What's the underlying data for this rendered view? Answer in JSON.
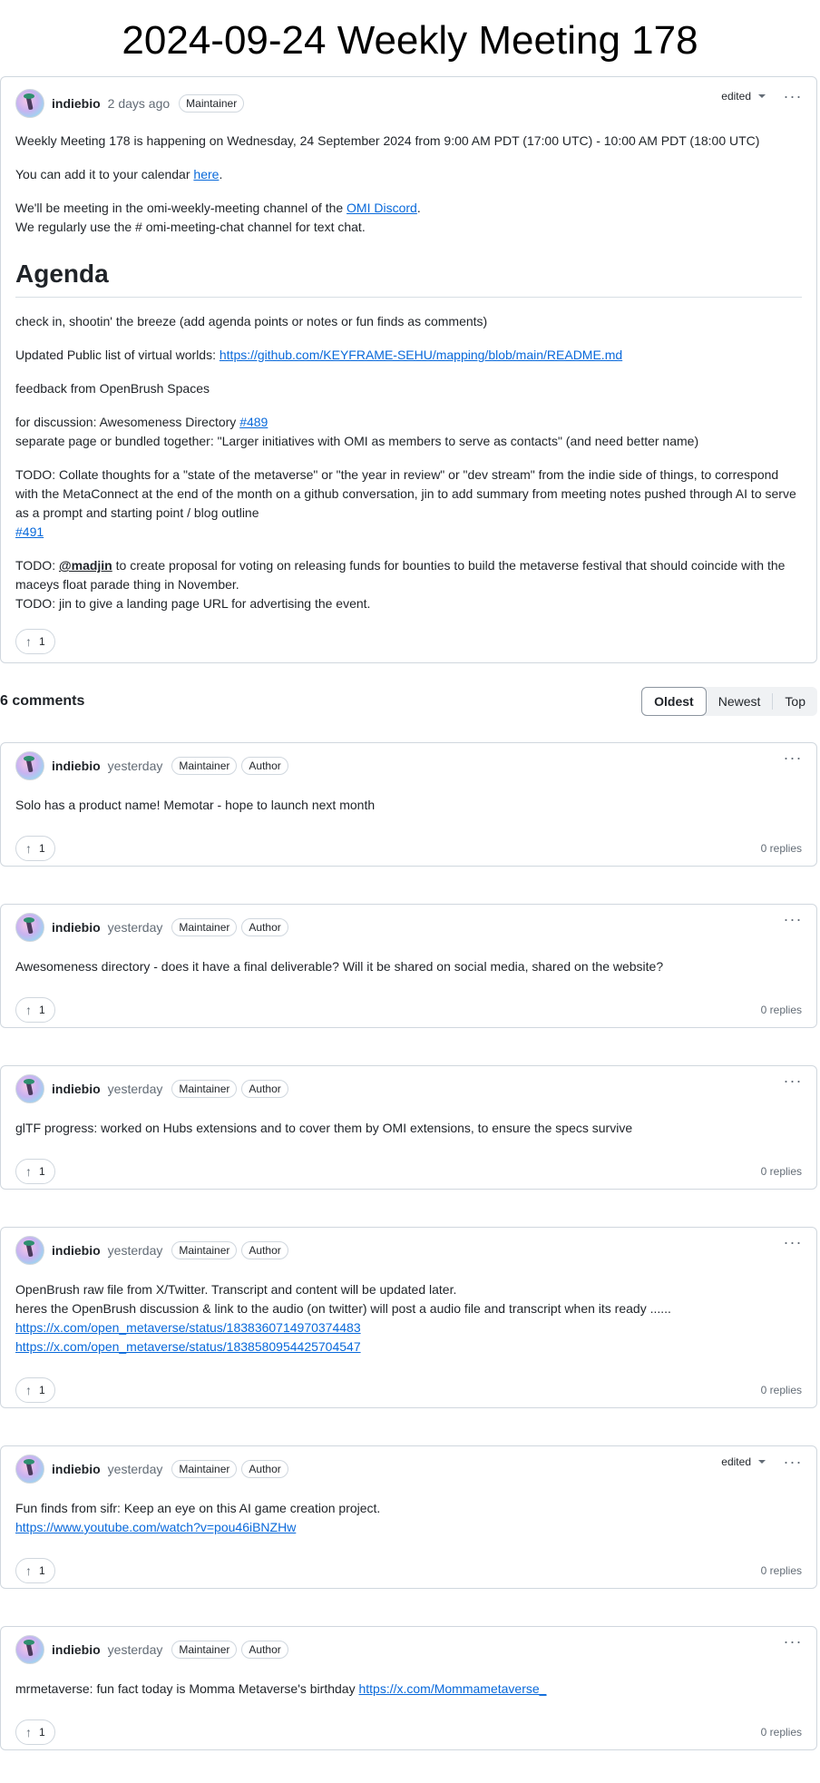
{
  "title": "2024-09-24 Weekly Meeting 178",
  "post": {
    "author": "indiebio",
    "time": "2 days ago",
    "badge": "Maintainer",
    "edited": "edited",
    "intro": "Weekly Meeting 178 is happening on Wednesday, 24 September 2024 from 9:00 AM PDT (17:00 UTC) - 10:00 AM PDT (18:00 UTC)",
    "calendar_text": "You can add it to your calendar ",
    "calendar_link": "here",
    "discord_text": "We'll be meeting in the omi-weekly-meeting channel of the ",
    "discord_link": "OMI Discord",
    "chat_text": "We regularly use the # omi-meeting-chat channel for text chat.",
    "agenda_heading": "Agenda",
    "item1": "check in, shootin' the breeze (add agenda points or notes or fun finds as comments)",
    "item2_text": "Updated Public list of virtual worlds: ",
    "item2_link": "https://github.com/KEYFRAME-SEHU/mapping/blob/main/README.md",
    "item3": "feedback from OpenBrush Spaces",
    "item4_text": "for discussion: Awesomeness Directory ",
    "item4_link": "#489",
    "item4_line2": "separate page or bundled together: \"Larger initiatives with OMI as members to serve as contacts\" (and need better name)",
    "item5_text": "TODO: Collate thoughts for a \"state of the metaverse\" or \"the year in review\" or \"dev stream\" from the indie side of things, to correspond with the MetaConnect at the end of the month on a github conversation, jin to add summary from meeting notes pushed through AI to serve as a prompt and starting point / blog outline",
    "item5_link": "#491",
    "item6_prefix": "TODO: ",
    "item6_mention": "@madjin",
    "item6_rest": " to create proposal for voting on releasing funds for bounties to build the metaverse festival that should coincide with the maceys float parade thing in November.",
    "item6_line2": "TODO: jin to give a landing page URL for advertising the event.",
    "reactions": "1"
  },
  "comments_header": {
    "count_label": "6 comments",
    "sort_options": [
      "Oldest",
      "Newest",
      "Top"
    ]
  },
  "comments": [
    {
      "author": "indiebio",
      "time": "yesterday",
      "badge1": "Maintainer",
      "badge2": "Author",
      "line1": "Solo has a product name! Memotar - hope to launch next month",
      "reactions": "1",
      "replies": "0 replies"
    },
    {
      "author": "indiebio",
      "time": "yesterday",
      "badge1": "Maintainer",
      "badge2": "Author",
      "line1": "Awesomeness directory - does it have a final deliverable? Will it be shared on social media, shared on the website?",
      "reactions": "1",
      "replies": "0 replies"
    },
    {
      "author": "indiebio",
      "time": "yesterday",
      "badge1": "Maintainer",
      "badge2": "Author",
      "line1": "glTF progress: worked on Hubs extensions and to cover them by OMI extensions, to ensure the specs survive",
      "reactions": "1",
      "replies": "0 replies"
    },
    {
      "author": "indiebio",
      "time": "yesterday",
      "badge1": "Maintainer",
      "badge2": "Author",
      "line1": "OpenBrush raw file from X/Twitter. Transcript and content will be updated later.",
      "line2": "heres the OpenBrush discussion & link to the audio (on twitter) will post a audio file and transcript when its ready ......",
      "link1": "https://x.com/open_metaverse/status/1838360714970374483",
      "link2": "https://x.com/open_metaverse/status/1838580954425704547",
      "reactions": "1",
      "replies": "0 replies"
    },
    {
      "author": "indiebio",
      "time": "yesterday",
      "badge1": "Maintainer",
      "badge2": "Author",
      "edited": "edited",
      "line1": "Fun finds from sifr: Keep an eye on this AI game creation project.",
      "link1": "https://www.youtube.com/watch?v=pou46iBNZHw",
      "reactions": "1",
      "replies": "0 replies"
    },
    {
      "author": "indiebio",
      "time": "yesterday",
      "badge1": "Maintainer",
      "badge2": "Author",
      "line1": "mrmetaverse: fun fact today is Momma Metaverse's birthday ",
      "link1": "https://x.com/Mommametaverse_",
      "reactions": "1",
      "replies": "0 replies"
    }
  ]
}
